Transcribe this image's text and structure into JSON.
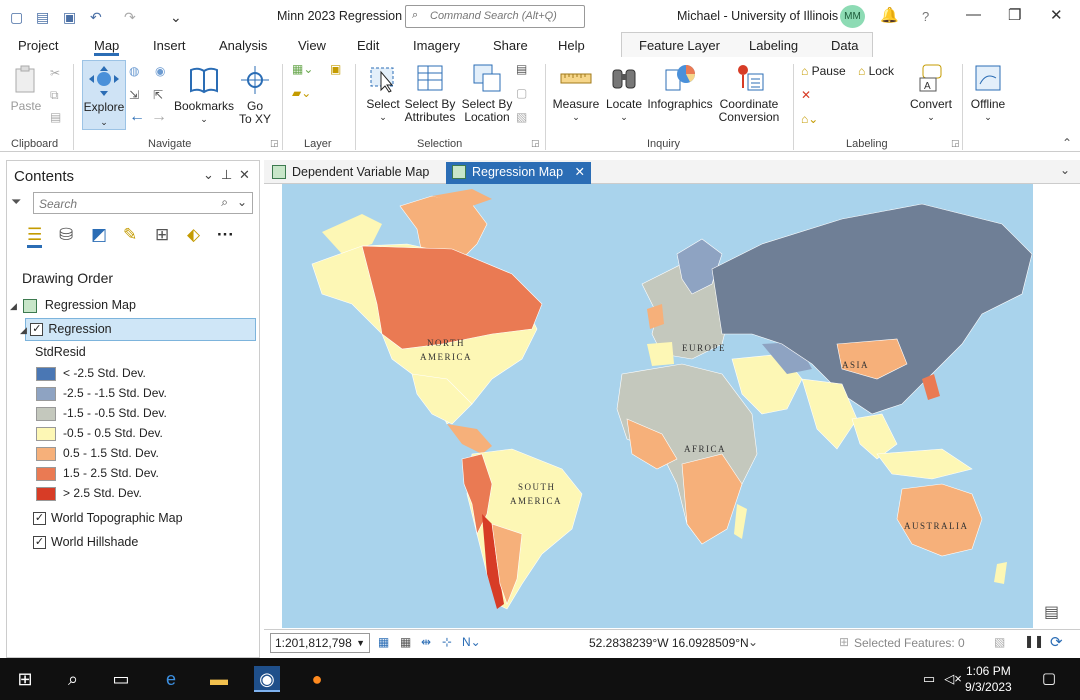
{
  "titlebar": {
    "title": "Minn 2023 Regression",
    "command_placeholder": "Command Search (Alt+Q)",
    "user": "Michael - University of Illinois",
    "initials": "MM",
    "help": "?"
  },
  "ribbon_tabs": [
    "Project",
    "Map",
    "Insert",
    "Analysis",
    "View",
    "Edit",
    "Imagery",
    "Share",
    "Help"
  ],
  "active_tab": "Map",
  "context_tabs": [
    "Feature Layer",
    "Labeling",
    "Data"
  ],
  "ribbon": {
    "clipboard": {
      "paste": "Paste",
      "group": "Clipboard"
    },
    "navigate": {
      "explore": "Explore",
      "bookmarks": "Bookmarks",
      "goto_line1": "Go",
      "goto_line2": "To XY",
      "group": "Navigate"
    },
    "layer": {
      "group": "Layer"
    },
    "selection": {
      "select": "Select",
      "by_attr_1": "Select By",
      "by_attr_2": "Attributes",
      "by_loc_1": "Select By",
      "by_loc_2": "Location",
      "group": "Selection"
    },
    "inquiry": {
      "measure": "Measure",
      "locate": "Locate",
      "infographics": "Infographics",
      "coord_1": "Coordinate",
      "coord_2": "Conversion",
      "group": "Inquiry"
    },
    "labeling": {
      "pause": "Pause",
      "lock": "Lock",
      "convert": "Convert",
      "group": "Labeling"
    },
    "offline": {
      "offline": "Offline"
    }
  },
  "contents": {
    "title": "Contents",
    "search_placeholder": "Search",
    "drawing_order": "Drawing Order",
    "map_name": "Regression Map",
    "layer": "Regression",
    "field": "StdResid",
    "legend": [
      {
        "label": "< -2.5 Std. Dev.",
        "color": "#4a77b4"
      },
      {
        "label": "-2.5 - -1.5 Std. Dev.",
        "color": "#8ea3c2"
      },
      {
        "label": "-1.5 - -0.5 Std. Dev.",
        "color": "#c4c8bd"
      },
      {
        "label": "-0.5 - 0.5 Std. Dev.",
        "color": "#fdf7b5"
      },
      {
        "label": "0.5 - 1.5 Std. Dev.",
        "color": "#f6b07a"
      },
      {
        "label": "1.5 - 2.5 Std. Dev.",
        "color": "#ea7a53"
      },
      {
        "label": "> 2.5 Std. Dev.",
        "color": "#d73c26"
      }
    ],
    "basemaps": [
      "World Topographic Map",
      "World Hillshade"
    ]
  },
  "map_tabs": [
    "Dependent Variable Map",
    "Regression Map"
  ],
  "active_map_tab": "Regression Map",
  "map_labels": {
    "north_america_1": "NORTH",
    "north_america_2": "AMERICA",
    "south_america_1": "SOUTH",
    "south_america_2": "AMERICA",
    "europe": "EUROPE",
    "africa": "AFRICA",
    "asia": "ASIA",
    "australia": "AUSTRALIA"
  },
  "statusbar": {
    "scale": "1:201,812,798",
    "coordinates": "52.2838239°W 16.0928509°N",
    "selected_features": "Selected Features: 0"
  },
  "taskbar": {
    "time": "1:06 PM",
    "date": "9/3/2023"
  }
}
